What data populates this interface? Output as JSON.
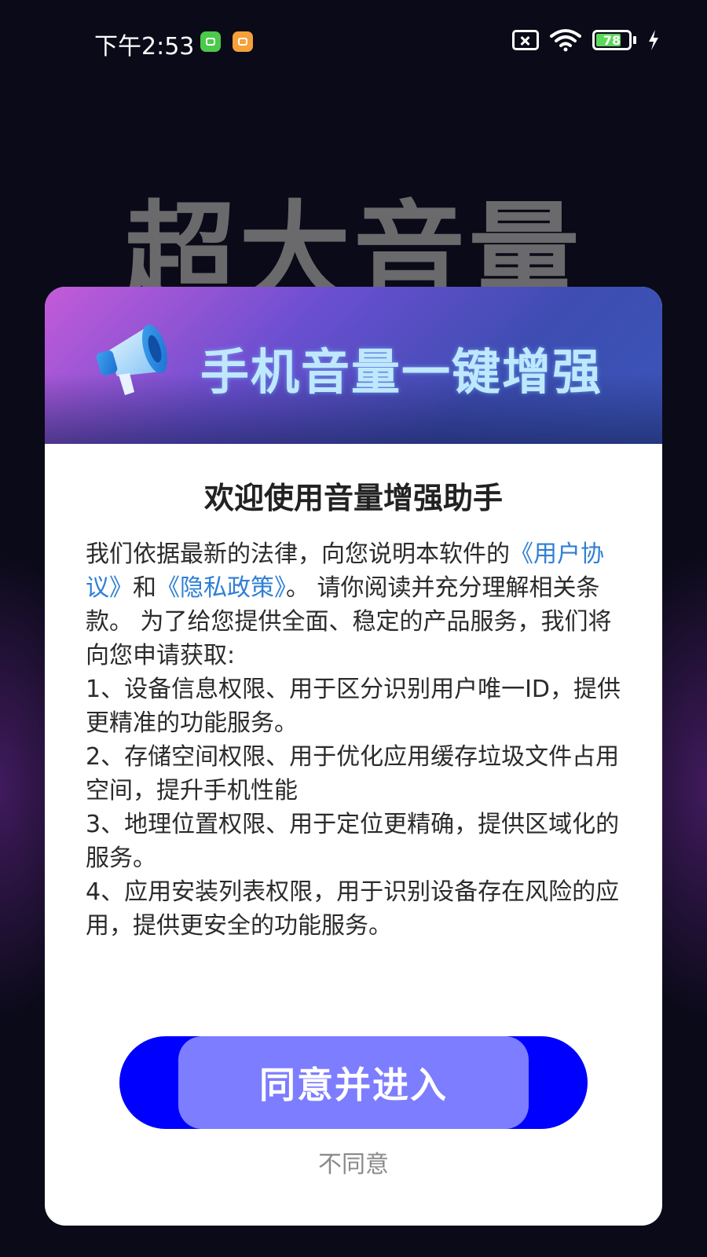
{
  "status_bar": {
    "time": "下午2:53",
    "battery": "78",
    "battery_level": 0.78,
    "icons": [
      "app-notification-icon",
      "calendar-icon",
      "no-sim-icon",
      "wifi-icon",
      "battery-icon",
      "charging-bolt-icon"
    ]
  },
  "background": {
    "headline": "超大音量"
  },
  "dialog": {
    "banner_title": "手机音量一键增强",
    "banner_icon": "megaphone-icon",
    "title": "欢迎使用音量增强助手",
    "intro_prefix": "我们依据最新的法律，向您说明本软件的",
    "user_agreement_link": "《用户协议》",
    "intro_and": "和",
    "privacy_policy_link": "《隐私政策》",
    "intro_suffix": "。 请你阅读并充分理解相关条款。 为了给您提供全面、稳定的产品服务，我们将向您申请获取:",
    "items": [
      "1、设备信息权限、用于区分识别用户唯一ID，提供更精准的功能服务。",
      "2、存储空间权限、用于优化应用缓存垃圾文件占用空间，提升手机性能",
      "3、地理位置权限、用于定位更精确，提供区域化的服务。",
      "4、应用安装列表权限，用于识别设备存在风险的应用，提供更安全的功能服务。"
    ],
    "agree_button": "同意并进入",
    "disagree_button": "不同意"
  },
  "colors": {
    "background": "#0a0a18",
    "link": "#2f7fd6",
    "agree_button_outer": "#0000ff",
    "agree_button_inner": "#7d7dff",
    "banner_text": "#bfe8ff"
  }
}
